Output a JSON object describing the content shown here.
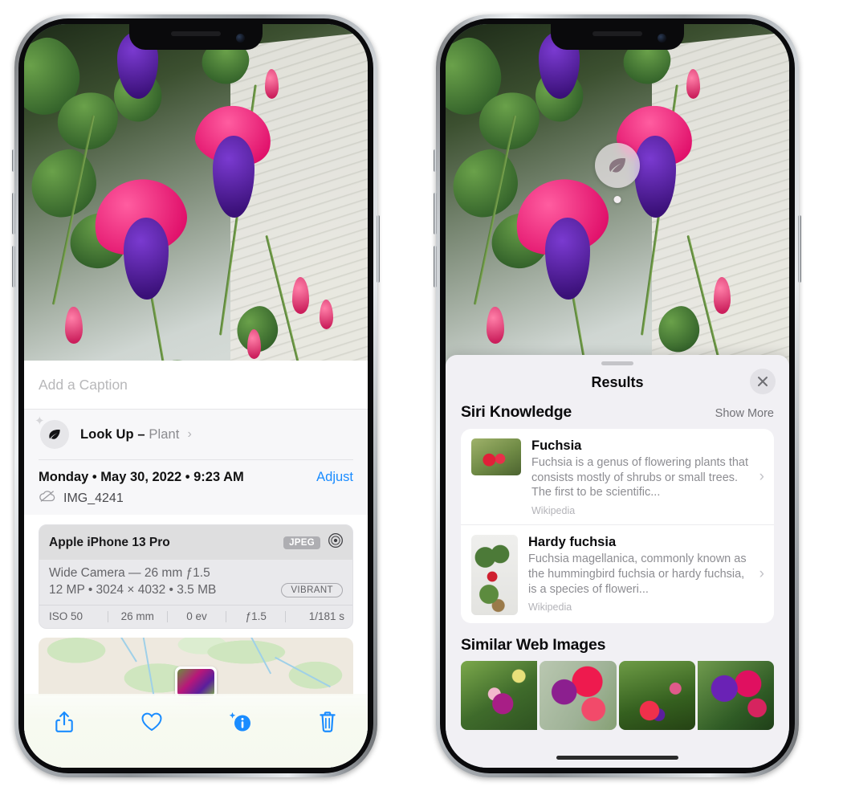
{
  "left_phone": {
    "caption_placeholder": "Add a Caption",
    "lookup": {
      "label": "Look Up – ",
      "subject": "Plant",
      "chevron": "›",
      "icon": "leaf-icon",
      "sparkle": "✦"
    },
    "meta": {
      "date": "Monday • May 30, 2022 • 9:23 AM",
      "adjust": "Adjust",
      "filename": "IMG_4241",
      "cloud_icon": "icloud-slash-icon"
    },
    "camera": {
      "model": "Apple iPhone 13 Pro",
      "format_tag": "JPEG",
      "aperture_icon": "aperture-icon",
      "lens": "Wide Camera — 26 mm ƒ1.5",
      "specs": "12 MP • 3024 × 4032 • 3.5 MB",
      "style_tag": "VIBRANT",
      "exif": [
        "ISO 50",
        "26 mm",
        "0 ev",
        "ƒ1.5",
        "1/181 s"
      ]
    },
    "toolbar": {
      "share_label": "share-icon",
      "favorite_label": "heart-icon",
      "info_label": "info-sparkle-icon",
      "delete_label": "trash-icon"
    },
    "accent_color": "#1a8cff"
  },
  "right_phone": {
    "badge_icon": "leaf-icon",
    "sheet": {
      "title": "Results",
      "close_label": "×",
      "sections": [
        {
          "title": "Siri Knowledge",
          "action": "Show More"
        },
        {
          "title": "Similar Web Images",
          "action": ""
        }
      ],
      "knowledge": [
        {
          "title": "Fuchsia",
          "description": "Fuchsia is a genus of flowering plants that consists mostly of shrubs or small trees. The first to be scientific...",
          "source": "Wikipedia",
          "chevron": "›"
        },
        {
          "title": "Hardy fuchsia",
          "description": "Fuchsia magellanica, commonly known as the hummingbird fuchsia or hardy fuchsia, is a species of floweri...",
          "source": "Wikipedia",
          "chevron": "›"
        }
      ],
      "web_images": [
        "web-image-1",
        "web-image-2",
        "web-image-3",
        "web-image-4"
      ]
    }
  }
}
